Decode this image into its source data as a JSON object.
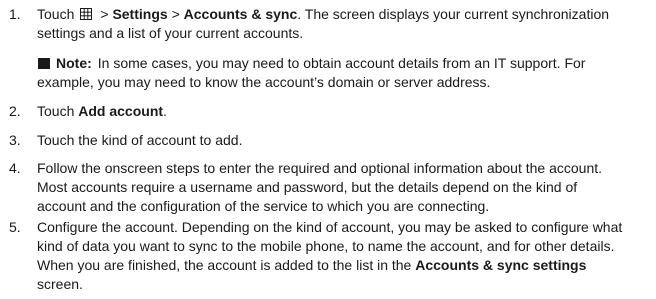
{
  "steps": [
    {
      "num": "1.",
      "pre": "Touch",
      "icon": "menu-grid-icon",
      "sep1": ">",
      "settings": "Settings",
      "sep2": ">",
      "accounts_sync": "Accounts & sync",
      "line1_rest": ". The screen displays your current synchronization",
      "line2": "settings and a list of your current accounts."
    },
    {
      "num": "2.",
      "pre": "Touch ",
      "bold": "Add account",
      "post": "."
    },
    {
      "num": "3.",
      "text": "Touch the kind of account to add."
    },
    {
      "num": "4.",
      "line1": "Follow the onscreen steps to enter the required and optional information about the account.",
      "line2": "Most accounts require a username and password, but the details depend on the kind of",
      "line3": "account and the configuration of the service to which you are connecting."
    },
    {
      "num": "5.",
      "line1": "Configure the account. Depending on the kind of account, you may be asked to configure what",
      "line2": "kind of data you want to sync to the mobile phone, to name the account, and for other details.",
      "line3_pre": "When you are finished, the account is added to the list in the ",
      "line3_bold": "Accounts & sync settings",
      "line4": "screen."
    }
  ],
  "note": {
    "label": "Note:",
    "line1": "In some cases, you may need to obtain account details from an IT support. For",
    "line2": "example, you may need to know the account’s domain or server address."
  }
}
